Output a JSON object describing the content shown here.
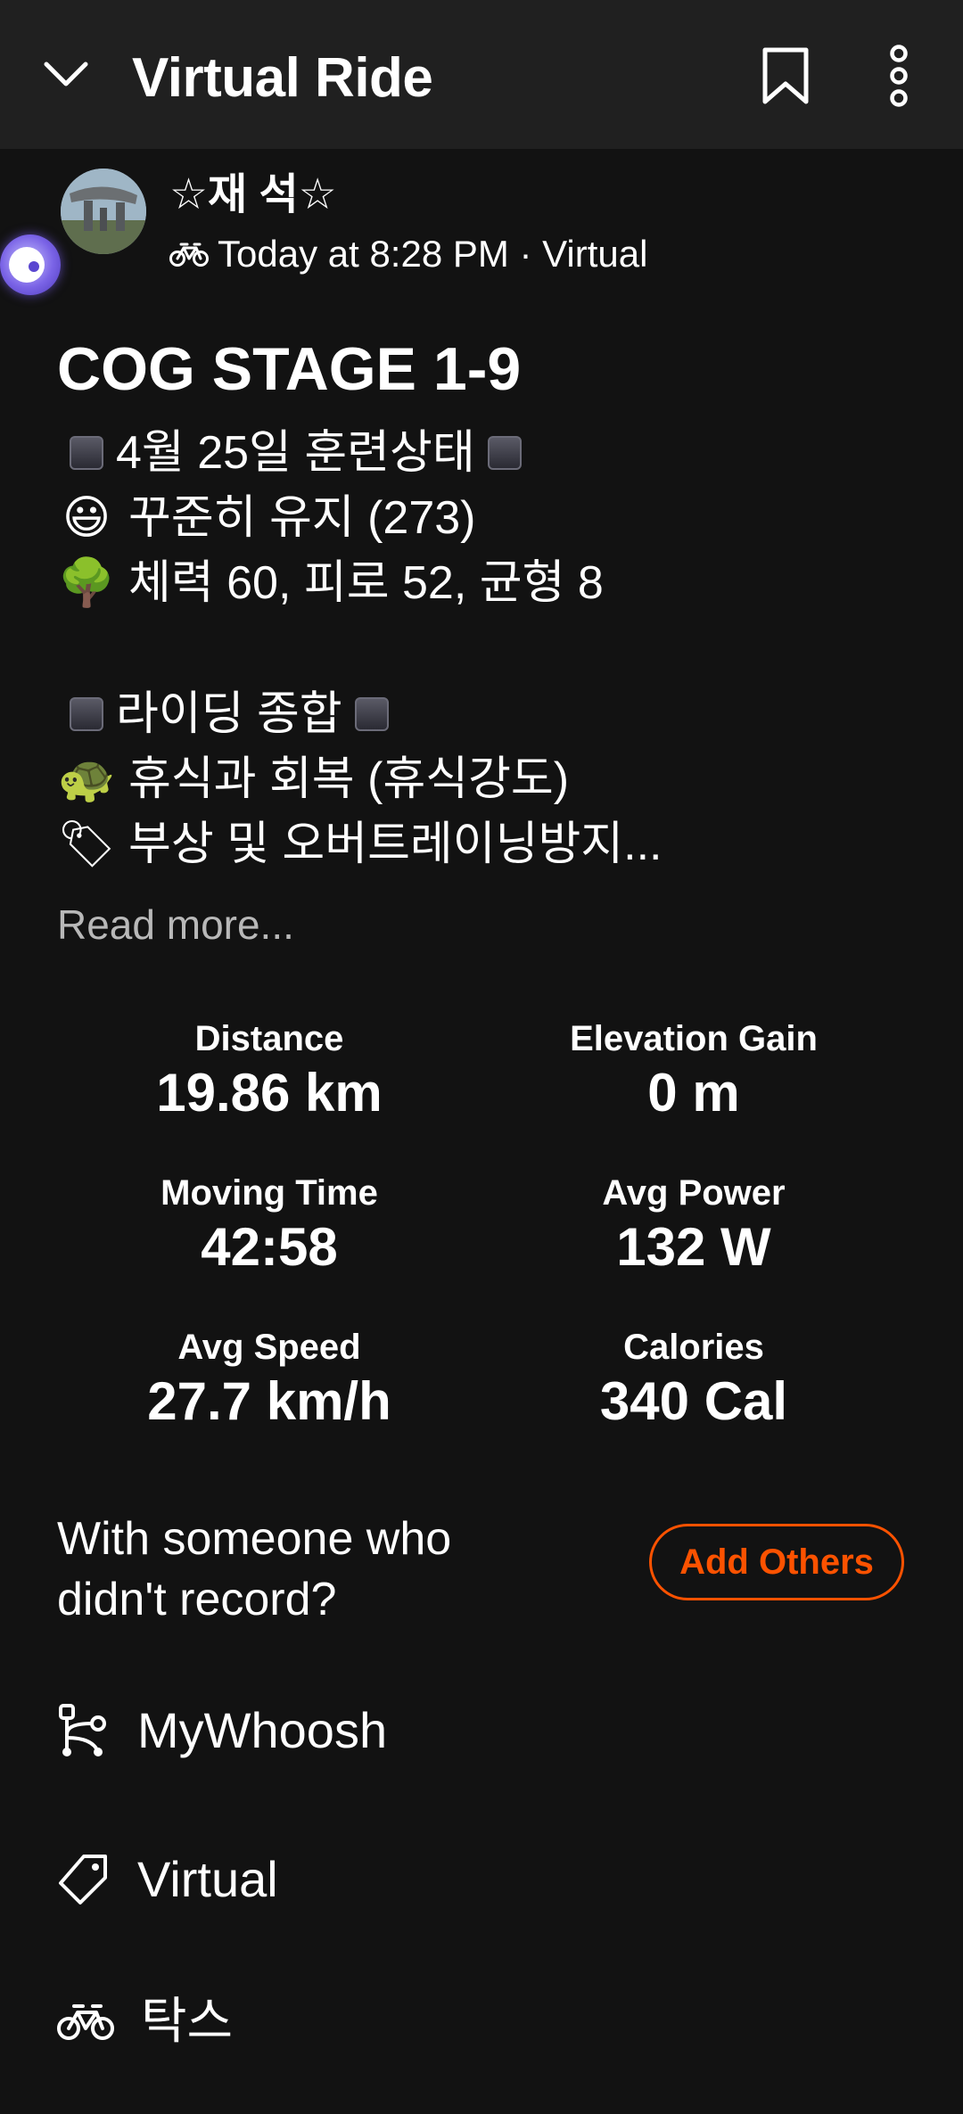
{
  "header": {
    "title": "Virtual Ride",
    "back_icon": "chevron-down-icon",
    "bookmark_icon": "bookmark-icon",
    "more_icon": "more-vertical-icon"
  },
  "athlete": {
    "name": "☆재 석☆",
    "timestamp": "Today at 8:28 PM · Virtual",
    "activity_icon": "bike-icon"
  },
  "activity": {
    "title": "COG STAGE 1-9",
    "description_lines": [
      {
        "prefix": "◼",
        "text": "4월 25일 훈련상태",
        "suffix": "◼"
      },
      {
        "prefix": "😃",
        "text": "꾸준히 유지 (273)"
      },
      {
        "prefix": "🌳",
        "text": "체력 60, 피로 52, 균형 8"
      },
      {
        "prefix": "◼",
        "text": "라이딩 종합",
        "suffix": "◼"
      },
      {
        "prefix": "🐢",
        "text": "휴식과 회복 (휴식강도)"
      },
      {
        "prefix": "🏷",
        "text": "부상 및 오버트레이닝방지..."
      }
    ],
    "read_more": "Read more..."
  },
  "stats": [
    {
      "label": "Distance",
      "value": "19.86 km"
    },
    {
      "label": "Elevation Gain",
      "value": "0 m"
    },
    {
      "label": "Moving Time",
      "value": "42:58"
    },
    {
      "label": "Avg Power",
      "value": "132 W"
    },
    {
      "label": "Avg Speed",
      "value": "27.7 km/h"
    },
    {
      "label": "Calories",
      "value": "340 Cal"
    }
  ],
  "with_others": {
    "prompt": "With someone who didn't record?",
    "button_label": "Add Others"
  },
  "details": [
    {
      "icon": "route-icon",
      "label": "MyWhoosh"
    },
    {
      "icon": "tag-icon",
      "label": "Virtual"
    },
    {
      "icon": "bike-icon",
      "label": "탁스"
    }
  ],
  "colors": {
    "background": "#121212",
    "app_bar": "#202020",
    "accent": "#fc5200",
    "muted_text": "#b8b8b8"
  }
}
